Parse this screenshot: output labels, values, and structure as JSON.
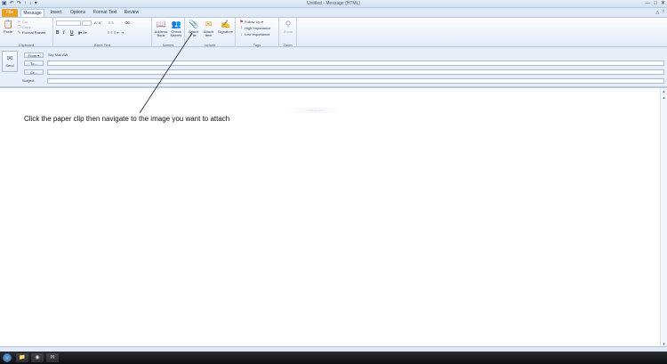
{
  "window": {
    "title": "Untitled - Message (HTML)",
    "qat_icons": [
      "save-icon",
      "undo-icon",
      "redo-icon",
      "up-arrow-icon",
      "down-arrow-icon",
      "customize-icon"
    ],
    "controls": [
      "minimize",
      "maximize",
      "close"
    ]
  },
  "tabs": [
    "File",
    "Message",
    "Insert",
    "Options",
    "Format Text",
    "Review"
  ],
  "ribbon": {
    "clipboard": {
      "paste": "Paste",
      "cut": "Cut",
      "copy": "Copy",
      "format_painter": "Format Painter",
      "label": "Clipboard"
    },
    "basic_text": {
      "bold": "B",
      "italic": "I",
      "underline": "U",
      "label": "Basic Text"
    },
    "names": {
      "address_book": "Address Book",
      "check_names": "Check Names",
      "label": "Names"
    },
    "include": {
      "attach_file": "Attach File",
      "attach_item": "Attach Item",
      "signature": "Signature",
      "label": "Include"
    },
    "tags": {
      "follow_up": "Follow Up",
      "high_importance": "High Importance",
      "low_importance": "Low Importance",
      "label": "Tags"
    },
    "zoom": {
      "zoom": "Zoom",
      "label": "Zoom"
    }
  },
  "compose": {
    "send": "Send",
    "from_button": "From",
    "from_value": "Sky Mail AW",
    "to_button": "To...",
    "cc_button": "Cc...",
    "subject_label": "Subject:"
  },
  "body": {
    "annotation": "Click the paper clip then navigate to the image you want to attach",
    "faint_text": "Windows Help"
  },
  "colors": {
    "file_tab": "#e8a023",
    "ribbon_border": "#b6c7de",
    "accent": "#1e395b"
  }
}
